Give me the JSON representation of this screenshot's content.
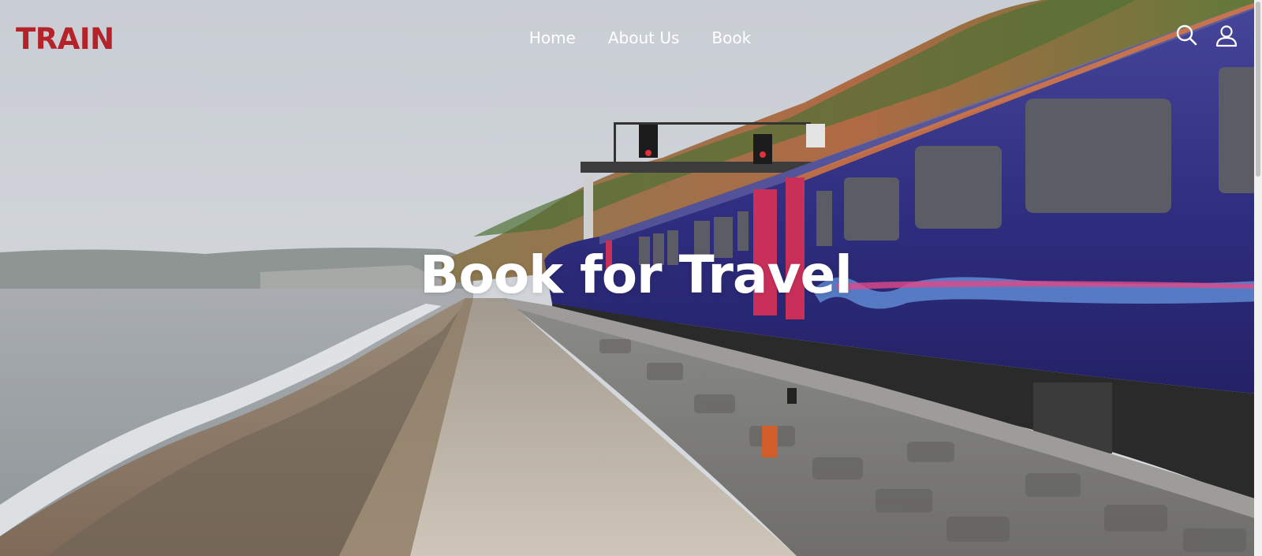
{
  "header": {
    "logo_text": "TRAIN",
    "nav": [
      {
        "label": "Home"
      },
      {
        "label": "About Us"
      },
      {
        "label": "Book"
      }
    ],
    "icons": [
      "search-icon",
      "user-icon"
    ]
  },
  "hero": {
    "headline": "Book for Travel",
    "image": "photo of a blue and pink passenger train running beside a stone sea wall along a coastal path"
  },
  "colors": {
    "brand": "#b5232a",
    "nav_text": "#ffffff",
    "train_body": "#2e2c7a",
    "train_door": "#c8305a"
  }
}
